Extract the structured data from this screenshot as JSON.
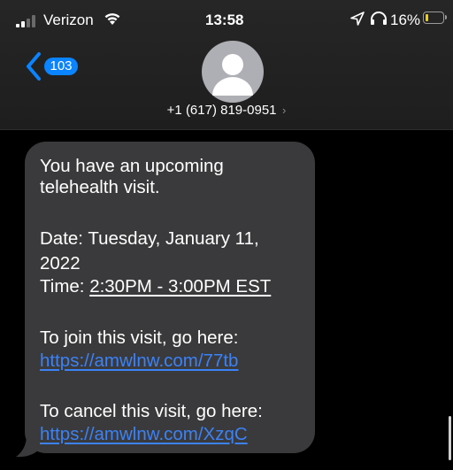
{
  "status_bar": {
    "carrier": "Verizon",
    "time": "13:58",
    "battery_percent": "16%",
    "battery_level": 0.16,
    "battery_color": "#f4d000",
    "signal_bars_active": 2,
    "icons": [
      "signal-icon",
      "wifi-icon",
      "location-arrow-icon",
      "headphones-icon",
      "battery-icon"
    ]
  },
  "header": {
    "back_badge": "103",
    "contact_number": "+1 (617) 819-0951",
    "contact_chevron": "›",
    "accent_color": "#0a84ff"
  },
  "message": {
    "line1": "You have an upcoming",
    "line2": "telehealth visit.",
    "date_line1": "Date: Tuesday, January 11,",
    "date_line2": "2022",
    "time_label": "Time: ",
    "time_value": "2:30PM - 3:00PM EST",
    "join_text": "To join this visit, go here:",
    "join_link": "https://amwlnw.com/77tb",
    "cancel_text": "To cancel this visit, go here:",
    "cancel_link": "https://amwlnw.com/XzqC",
    "bubble_color": "#3a3a3c",
    "link_color": "#3b82f6"
  }
}
